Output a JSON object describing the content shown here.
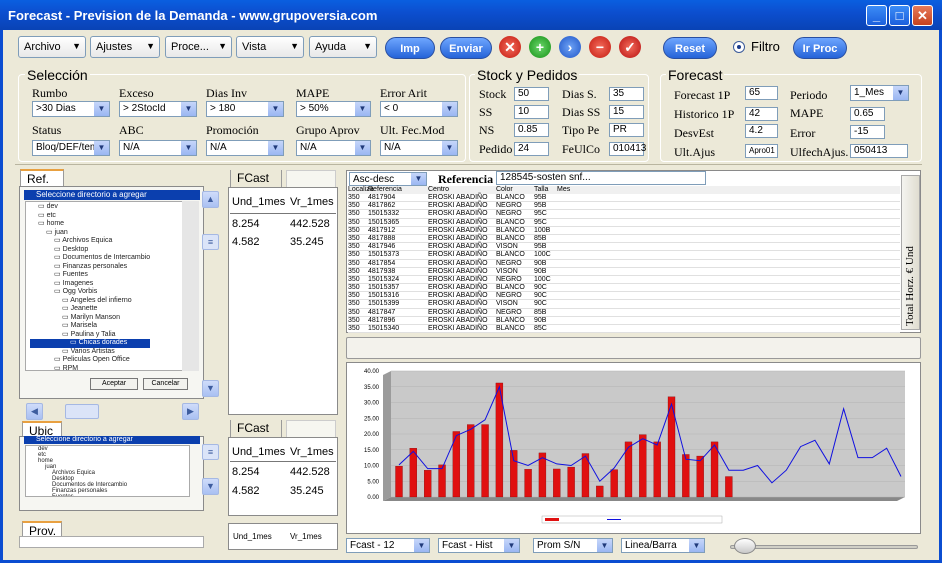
{
  "window": {
    "title": "Forecast - Prevision de la Demanda - www.grupoversia.com",
    "min": "_",
    "max": "□",
    "close": "✕"
  },
  "menus": [
    {
      "label": "Archivo"
    },
    {
      "label": "Ajustes"
    },
    {
      "label": "Proce..."
    },
    {
      "label": "Vista"
    },
    {
      "label": "Ayuda"
    }
  ],
  "toolbar": {
    "imp": "Imp",
    "enviar": "Enviar",
    "reset": "Reset",
    "filtro": "Filtro",
    "irproc": "Ir Proc"
  },
  "seleccion": {
    "title": "Selección",
    "rumbo_l": "Rumbo",
    "rumbo_v": ">30 Dias",
    "exceso_l": "Exceso",
    "exceso_v": "> 2StocId",
    "dias_l": "Dias Inv",
    "dias_v": "> 180",
    "mape_l": "MAPE",
    "mape_v": "> 50%",
    "error_l": "Error Arit",
    "error_v": "< 0",
    "status_l": "Status",
    "status_v": "Bloq/DEF/tem",
    "abc_l": "ABC",
    "abc_v": "N/A",
    "promo_l": "Promoción",
    "promo_v": "N/A",
    "grupo_l": "Grupo Aprov",
    "grupo_v": "N/A",
    "ult_l": "Ult. Fec.Mod",
    "ult_v": "N/A"
  },
  "stock": {
    "title": "Stock y Pedidos",
    "stock_l": "Stock",
    "stock_v": "50",
    "diass_l": "Dias S.",
    "diass_v": "35",
    "ss_l": "SS",
    "ss_v": "10",
    "diasss_l": "Dias SS",
    "diasss_v": "15",
    "ns_l": "NS",
    "ns_v": "0.85",
    "tipo_l": "Tipo Pe",
    "tipo_v": "PR",
    "pedido_l": "Pedido",
    "pedido_v": "24",
    "feulco_l": "FeUlCo",
    "feulco_v": "010413"
  },
  "forecast": {
    "title": "Forecast",
    "f1p_l": "Forecast 1P",
    "f1p_v": "65",
    "periodo_l": "Periodo",
    "periodo_v": "1_Mes",
    "h1p_l": "Historico 1P",
    "h1p_v": "42",
    "mape_l": "MAPE",
    "mape_v": "0.65",
    "desv_l": "DesvEst",
    "desv_v": "4.2",
    "error_l": "Error",
    "error_v": "-15",
    "ultajus_l": "Ult.Ajus",
    "ultajus_v": "Apro01",
    "ulfech_l": "UlfechAjus.",
    "ulfech_v": "050413"
  },
  "tabs": {
    "ref": "Ref.",
    "ubic": "Ubic",
    "prov": "Prov.",
    "fcast1": "FCast",
    "fcast2": "FCast"
  },
  "tree1": {
    "header": "Seleccione directorio a agregar",
    "items": [
      "dev",
      "etc",
      "home",
      "juan",
      "Archivos Equica",
      "Desktop",
      "Documentos de Intercambio",
      "Finanzas personales",
      "Fuentes",
      "Imagenes",
      "Ogg Vorbis",
      "Angeles del infierno",
      "Jeanette",
      "Marilyn Manson",
      "Marisela",
      "Paulina y Talia",
      "Chicas dorades",
      "Varios Artistas",
      "Peliculas Open Office",
      "RPM"
    ],
    "accept": "Aceptar",
    "cancel": "Cancelar"
  },
  "tree2": {
    "header": "Seleccione directorio a agregar",
    "items": [
      "dev",
      "etc",
      "home",
      "juan",
      "Archivos Equica",
      "Desktop",
      "Documentos de Intercambio",
      "Finanzas personales",
      "Fuentes"
    ]
  },
  "fcast_table": {
    "h1": "Und_1mes",
    "h2": "Vr_1mes",
    "rows": [
      [
        "8.254",
        "442.528"
      ],
      [
        "4.582",
        "35.245"
      ]
    ]
  },
  "fcast_table2": {
    "h1": "Und_1mes",
    "h2": "Vr_1mes",
    "rows": [
      [
        "8.254",
        "442.528"
      ],
      [
        "4.582",
        "35.245"
      ]
    ]
  },
  "fcast_table3": {
    "h1": "Und_1mes",
    "h2": "Vr_1mes"
  },
  "grid": {
    "sort": "Asc-desc",
    "ref_l": "Referencia",
    "ref_v": "128545-sosten snf...",
    "headers": [
      "Localiza",
      "Referencia",
      "Centro",
      "Color",
      "Talla",
      "Mes"
    ],
    "side": "Total Horz. € Und",
    "rows": [
      [
        "350",
        "4817904",
        "EROSKI ABADIÑO",
        "BLANCO",
        "95B"
      ],
      [
        "350",
        "4817862",
        "EROSKI ABADIÑO",
        "NEGRO",
        "95B"
      ],
      [
        "350",
        "15015332",
        "EROSKI ABADIÑO",
        "NEGRO",
        "95C"
      ],
      [
        "350",
        "15015365",
        "EROSKI ABADIÑO",
        "BLANCO",
        "95C"
      ],
      [
        "350",
        "4817912",
        "EROSKI ABADIÑO",
        "BLANCO",
        "100B"
      ],
      [
        "350",
        "4817888",
        "EROSKI ABADIÑO",
        "BLANCO",
        "85B"
      ],
      [
        "350",
        "4817946",
        "EROSKI ABADIÑO",
        "VISON",
        "95B"
      ],
      [
        "350",
        "15015373",
        "EROSKI ABADIÑO",
        "BLANCO",
        "100C"
      ],
      [
        "350",
        "4817854",
        "EROSKI ABADIÑO",
        "NEGRO",
        "90B"
      ],
      [
        "350",
        "4817938",
        "EROSKI ABADIÑO",
        "VISON",
        "90B"
      ],
      [
        "350",
        "15015324",
        "EROSKI ABADIÑO",
        "NEGRO",
        "100C"
      ],
      [
        "350",
        "15015357",
        "EROSKI ABADIÑO",
        "BLANCO",
        "90C"
      ],
      [
        "350",
        "15015316",
        "EROSKI ABADIÑO",
        "NEGRO",
        "90C"
      ],
      [
        "350",
        "15015399",
        "EROSKI ABADIÑO",
        "VISON",
        "90C"
      ],
      [
        "350",
        "4817847",
        "EROSKI ABADIÑO",
        "NEGRO",
        "85B"
      ],
      [
        "350",
        "4817896",
        "EROSKI ABADIÑO",
        "BLANCO",
        "90B"
      ],
      [
        "350",
        "15015340",
        "EROSKI ABADIÑO",
        "BLANCO",
        "85C"
      ]
    ]
  },
  "bottom": {
    "b1": "Fcast - 12",
    "b2": "Fcast - Hist",
    "b3": "Prom S/N",
    "b4": "Linea/Barra"
  },
  "chart_data": {
    "type": "bar",
    "ylim": [
      0,
      40
    ],
    "yticks": [
      "0.00",
      "5.00",
      "10.00",
      "15.00",
      "20.00",
      "25.00",
      "30.00",
      "35.00",
      "40.00"
    ],
    "bars": [
      9.8,
      15.5,
      8.5,
      10.2,
      20.8,
      23,
      23,
      36.2,
      14.8,
      8.8,
      14,
      8.9,
      9.5,
      13.8,
      3.5,
      8.7,
      17.5,
      19.8,
      17.5,
      31.8,
      13.5,
      13,
      17.5,
      6.5
    ],
    "line": [
      10.2,
      14.5,
      9,
      9,
      19.5,
      21.5,
      24.5,
      35,
      11.5,
      10,
      12.5,
      10.5,
      10,
      13,
      5,
      9.2,
      15.8,
      18.5,
      16.5,
      29.5,
      12,
      11.5,
      16.5,
      8.5,
      8.5,
      10,
      4.5,
      8.5,
      16,
      18,
      10.5,
      28,
      12.5,
      12.5,
      15.5,
      6.5
    ],
    "legend": "",
    "colors": {
      "bar": "#e01010",
      "line": "#1010e0"
    }
  }
}
